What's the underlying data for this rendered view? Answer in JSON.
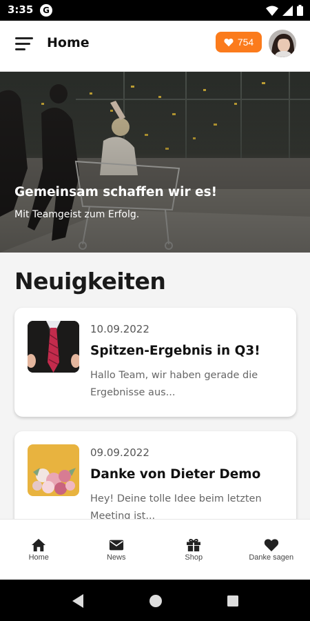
{
  "status_bar": {
    "time": "3:35",
    "app_icon_letter": "G",
    "icons": [
      "wifi-icon",
      "signal-icon",
      "battery-icon"
    ]
  },
  "app_bar": {
    "title": "Home",
    "points": "754",
    "points_icon": "heart-icon",
    "accent_color": "#fb7b1c"
  },
  "hero": {
    "title": "Gemeinsam schaffen wir es!",
    "subtitle": "Mit Teamgeist zum Erfolg."
  },
  "news": {
    "section_title": "Neuigkeiten",
    "items": [
      {
        "date": "10.09.2022",
        "title": "Spitzen-Ergebnis in Q3!",
        "excerpt_line1": "Hallo Team, wir haben gerade die",
        "excerpt_line2": "Ergebnisse aus..."
      },
      {
        "date": "09.09.2022",
        "title": "Danke von Dieter Demo",
        "excerpt_line1": "Hey! Deine tolle Idee beim letzten",
        "excerpt_line2": "Meeting ist..."
      }
    ]
  },
  "bottom_nav": {
    "items": [
      {
        "label": "Home",
        "icon": "home-icon"
      },
      {
        "label": "News",
        "icon": "envelope-icon"
      },
      {
        "label": "Shop",
        "icon": "gift-icon"
      },
      {
        "label": "Danke sagen",
        "icon": "heart-icon"
      }
    ]
  }
}
